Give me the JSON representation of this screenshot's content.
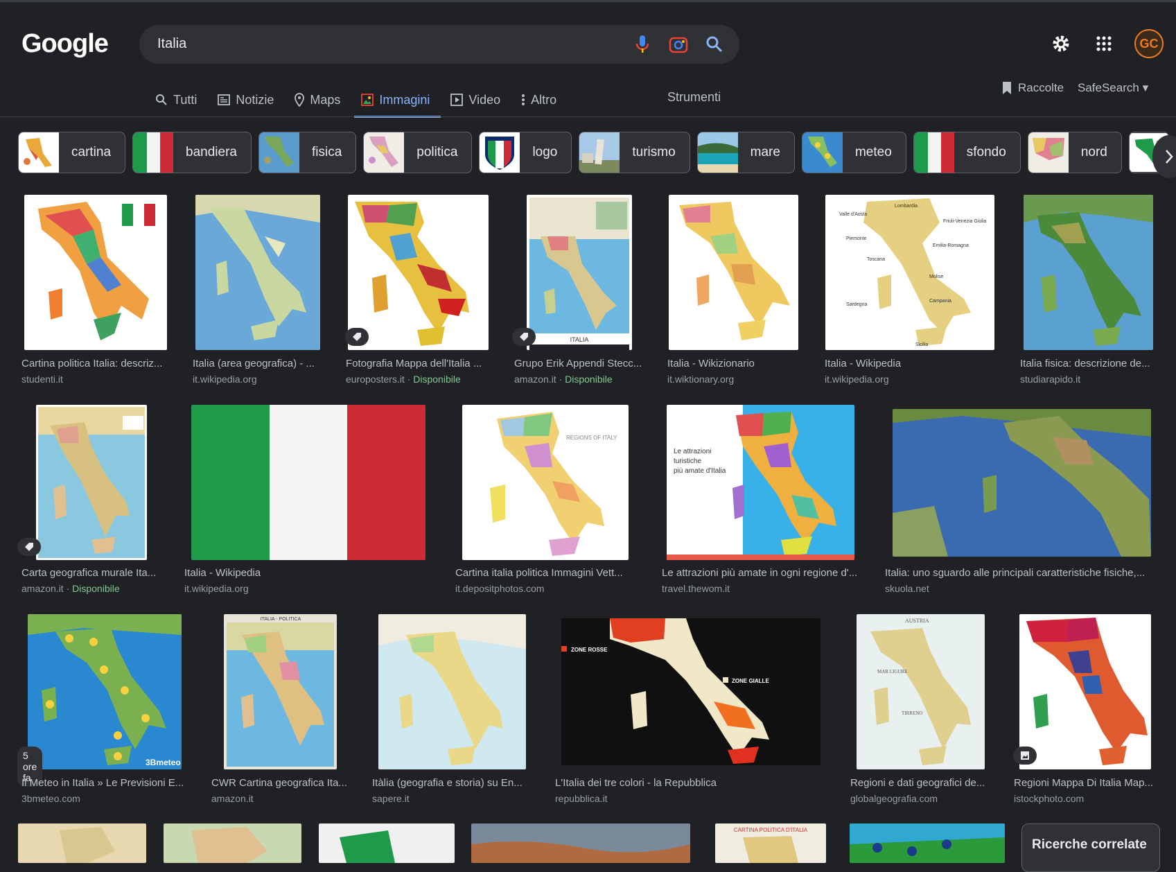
{
  "logo": "Google",
  "search": {
    "query": "Italia"
  },
  "icons": {
    "mic": "mic-icon",
    "lens": "lens-icon",
    "search": "search-icon",
    "settings": "gear-icon",
    "apps": "apps-grid-icon"
  },
  "avatar_initials": "GC",
  "tabs": [
    {
      "label": "Tutti",
      "icon": "search-icon"
    },
    {
      "label": "Notizie",
      "icon": "news-icon"
    },
    {
      "label": "Maps",
      "icon": "pin-icon"
    },
    {
      "label": "Immagini",
      "icon": "image-icon",
      "active": true
    },
    {
      "label": "Video",
      "icon": "play-icon"
    },
    {
      "label": "Altro",
      "icon": "more-icon"
    }
  ],
  "tools_label": "Strumenti",
  "raccolte_label": "Raccolte",
  "safesearch_label": "SafeSearch",
  "chips": [
    "cartina",
    "bandiera",
    "fisica",
    "politica",
    "logo",
    "turismo",
    "mare",
    "meteo",
    "sfondo",
    "nord"
  ],
  "results": [
    {
      "title": "Cartina politica Italia: descriz...",
      "source": "studenti.it",
      "available": ""
    },
    {
      "title": "Italia (area geografica) - ...",
      "source": "it.wikipedia.org",
      "available": ""
    },
    {
      "title": "Fotografia Mappa dell'Italia ...",
      "source": "europosters.it · ",
      "available": "Disponibile"
    },
    {
      "title": "Grupo Erik Appendi Stecc...",
      "source": "amazon.it · ",
      "available": "Disponibile"
    },
    {
      "title": "Italia - Wikizionario",
      "source": "it.wiktionary.org",
      "available": ""
    },
    {
      "title": "Italia - Wikipedia",
      "source": "it.wikipedia.org",
      "available": ""
    },
    {
      "title": "Italia fisica: descrizione de...",
      "source": "studiarapido.it",
      "available": ""
    },
    {
      "title": "Carta geografica murale Ita...",
      "source": "amazon.it · ",
      "available": "Disponibile"
    },
    {
      "title": "Italia - Wikipedia",
      "source": "it.wikipedia.org",
      "available": ""
    },
    {
      "title": "Cartina italia politica Immagini Vett...",
      "source": "it.depositphotos.com",
      "available": ""
    },
    {
      "title": "Le attrazioni più amate in ogni regione d'...",
      "source": "travel.thewom.it",
      "available": ""
    },
    {
      "title": "Italia: uno sguardo alle principali caratteristiche fisiche,...",
      "source": "skuola.net",
      "available": ""
    },
    {
      "title": "Il Meteo in Italia » Le Previsioni E...",
      "source": "3bmeteo.com",
      "available": ""
    },
    {
      "title": "CWR Cartina geografica Ita...",
      "source": "amazon.it",
      "available": ""
    },
    {
      "title": "Itàlia (geografia e storia) su En...",
      "source": "sapere.it",
      "available": ""
    },
    {
      "title": "L'Italia dei tre colori - la Repubblica",
      "source": "repubblica.it",
      "available": ""
    },
    {
      "title": "Regioni e dati geografici de...",
      "source": "globalgeografia.com",
      "available": ""
    },
    {
      "title": "Regioni Mappa Di Italia Map...",
      "source": "istockphoto.com",
      "available": ""
    }
  ],
  "time_badge": "5 ore fa",
  "ricerche_label": "Ricerche correlate"
}
